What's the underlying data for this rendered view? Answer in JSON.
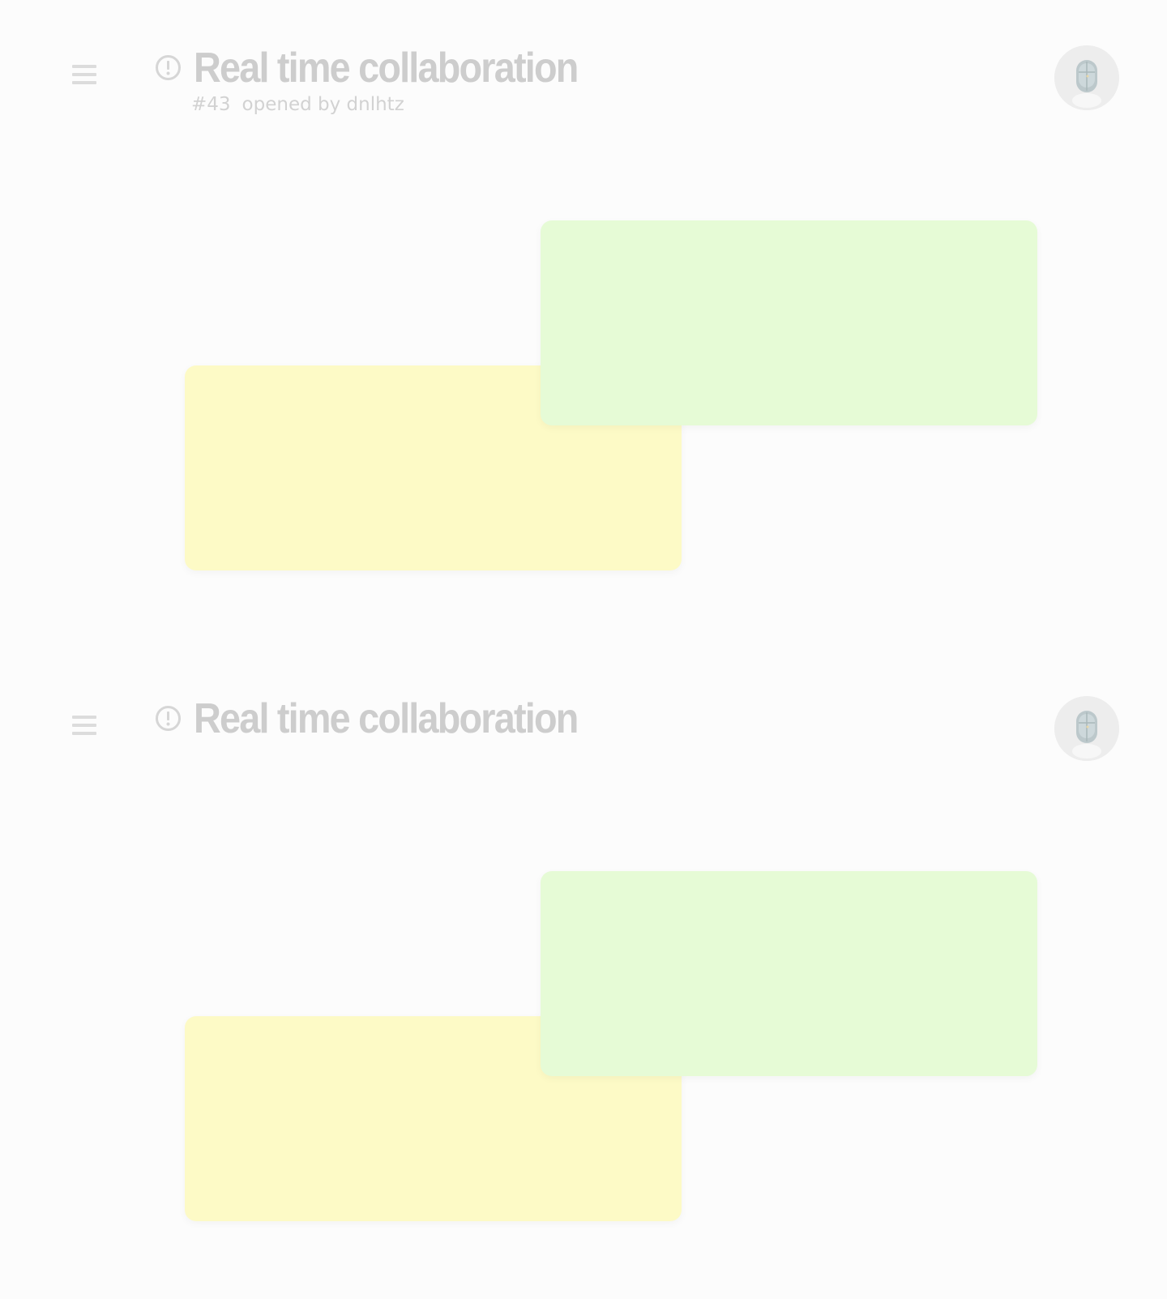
{
  "issue_1": {
    "title": "Real time collaboration",
    "number": "#43",
    "opened_by": "opened by dnlhtz"
  },
  "issue_2": {
    "title": "Real time collaboration"
  },
  "colors": {
    "background": "#fcfcfc",
    "title_text": "#cdcdcd",
    "yellow_card": "#fdfac6",
    "green_card": "#e6fbd6"
  },
  "icons": {
    "menu": "hamburger-menu-icon",
    "status": "issue-open-icon",
    "avatar": "user-avatar"
  }
}
